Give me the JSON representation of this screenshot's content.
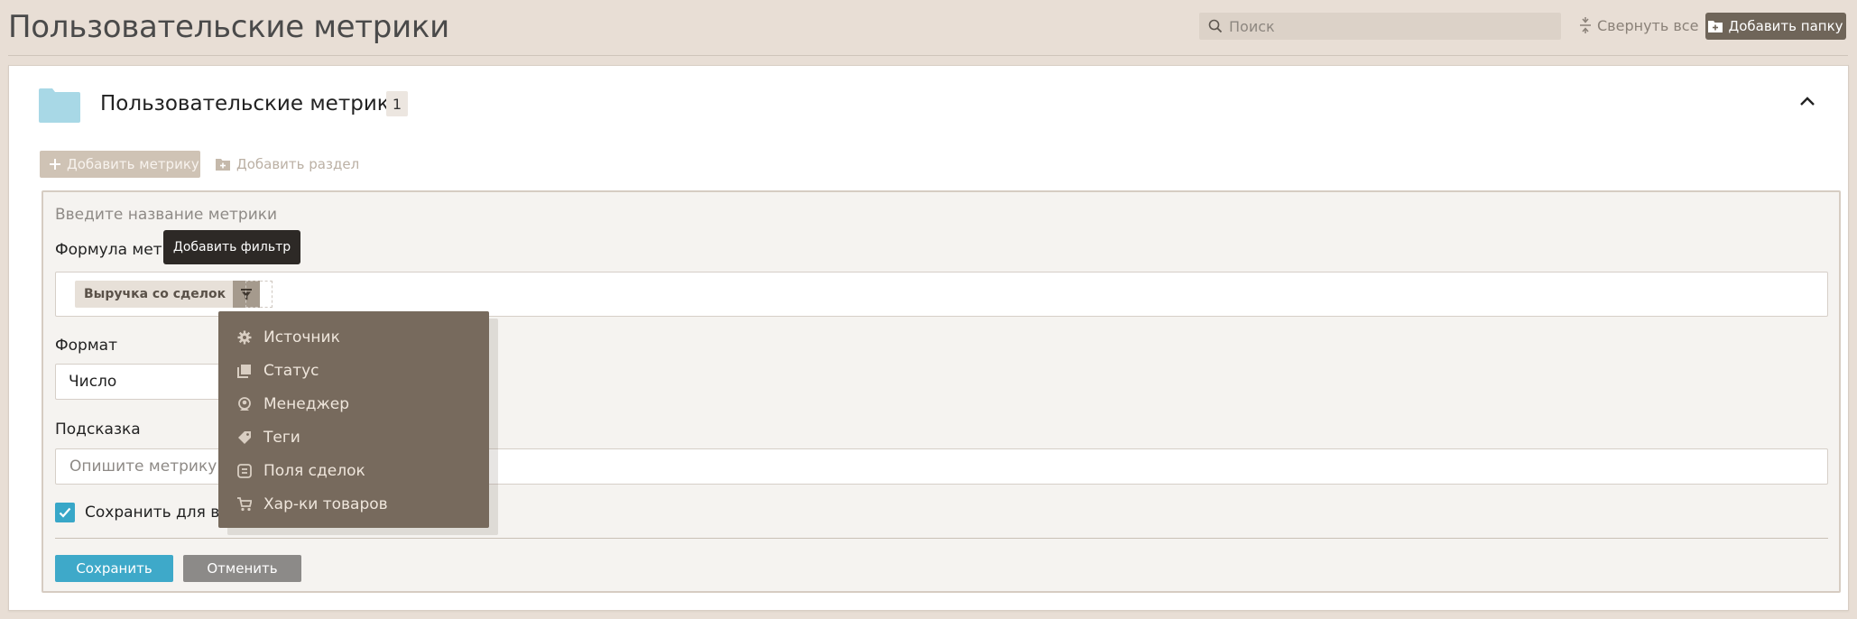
{
  "header": {
    "title": "Пользовательские метрики",
    "search_placeholder": "Поиск",
    "collapse_all_label": "Свернуть все",
    "add_folder_label": "Добавить папку"
  },
  "folder": {
    "title": "Пользовательские метрики",
    "count": "1",
    "add_metric_label": "Добавить метрику",
    "add_section_label": "Добавить раздел"
  },
  "form": {
    "name_placeholder": "Введите название метрики",
    "formula_label": "Формула метр",
    "formula_chip": "Выручка со сделок",
    "format_label": "Формат",
    "format_value": "Число",
    "hint_label": "Подсказка",
    "hint_placeholder": "Опишите метрику",
    "save_for_all_label": "Сохранить для вс",
    "save_for_all_checked": true,
    "save_label": "Сохранить",
    "cancel_label": "Отменить"
  },
  "tooltip": {
    "text": "Добавить фильтр"
  },
  "filter_menu": {
    "items": [
      {
        "label": "Источник",
        "icon": "gear-icon"
      },
      {
        "label": "Статус",
        "icon": "copy-icon"
      },
      {
        "label": "Менеджер",
        "icon": "user-icon"
      },
      {
        "label": "Теги",
        "icon": "tag-icon"
      },
      {
        "label": "Поля сделок",
        "icon": "fields-icon"
      },
      {
        "label": "Хар-ки товаров",
        "icon": "cart-icon"
      }
    ]
  },
  "colors": {
    "background": "#e8ded5",
    "accent": "#3ea9c9",
    "dropdown": "#776a5d",
    "folder_icon": "#a8d8e6"
  }
}
